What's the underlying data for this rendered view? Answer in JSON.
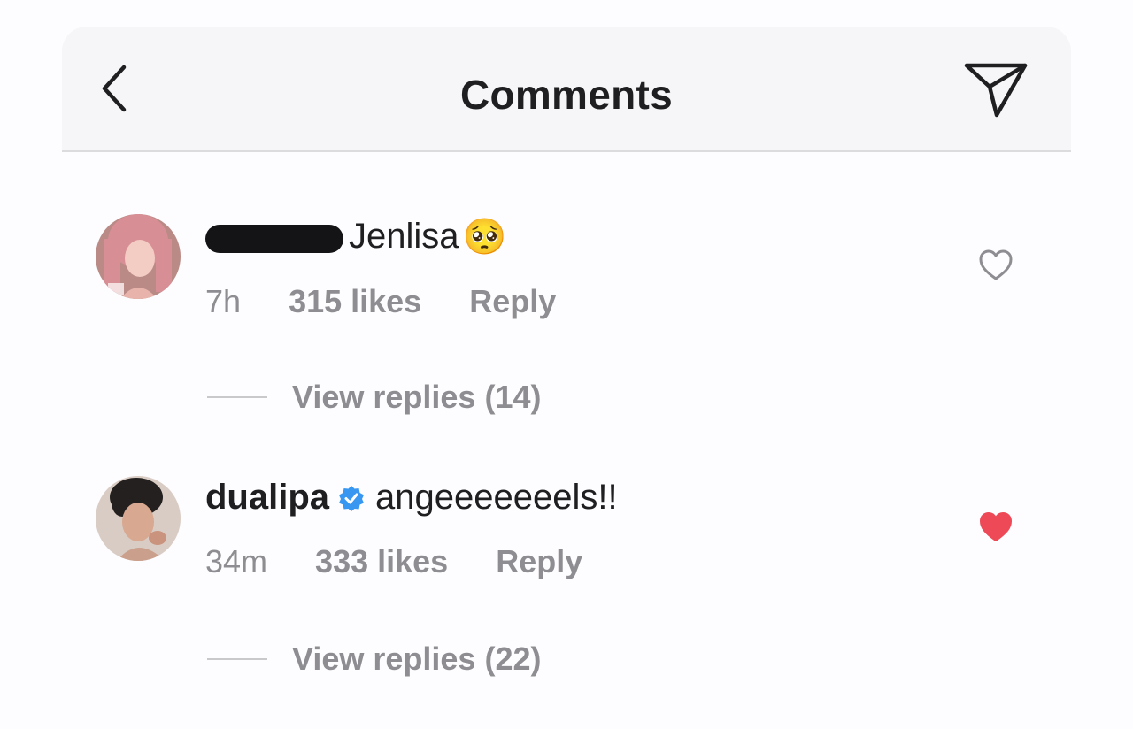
{
  "header": {
    "title": "Comments",
    "back_icon": "chevron-left-icon",
    "share_icon": "paper-plane-icon"
  },
  "comments": [
    {
      "username": "",
      "username_redacted": true,
      "text": "Jenlisa",
      "emoji": "🥺",
      "time": "7h",
      "likes": "315 likes",
      "reply": "Reply",
      "liked": false,
      "view_replies": "View replies (14)"
    },
    {
      "username": "dualipa",
      "verified": true,
      "text": "angeeeeeeels!!",
      "time": "34m",
      "likes": "333 likes",
      "reply": "Reply",
      "liked": true,
      "view_replies": "View replies (22)"
    }
  ],
  "colors": {
    "liked_heart": "#ed4956",
    "verified_badge": "#3897f0",
    "meta_text": "#8e8e92"
  }
}
